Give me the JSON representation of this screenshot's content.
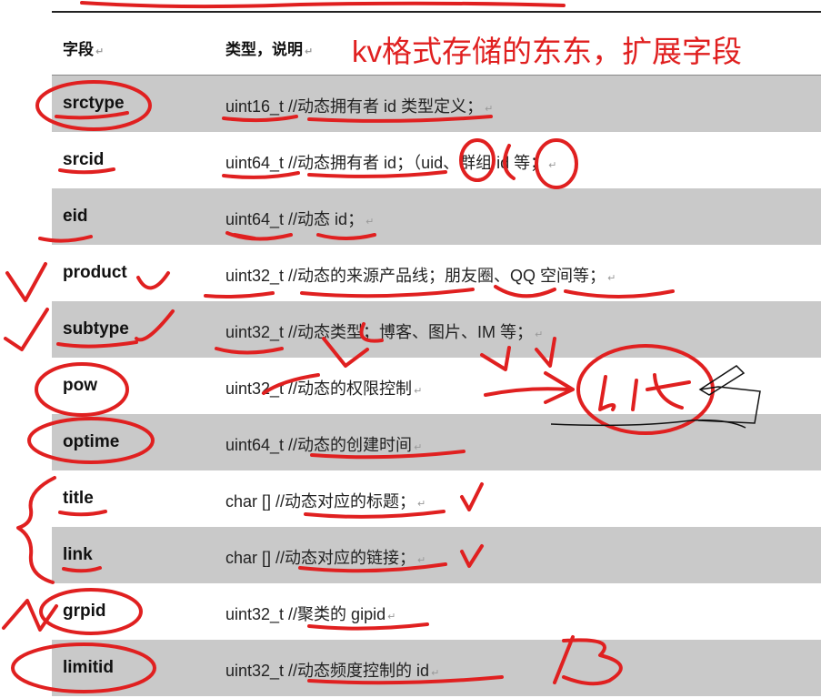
{
  "header": {
    "col_field": "字段",
    "col_type": "类型，说明",
    "annotation": "kv格式存储的东东，扩展字段"
  },
  "rows": [
    {
      "field": "srctype",
      "desc": "uint16_t //动态拥有者 id 类型定义；"
    },
    {
      "field": "srcid",
      "desc": "uint64_t //动态拥有者 id；（uid、群组 id 等；"
    },
    {
      "field": "eid",
      "desc": "uint64_t //动态 id；"
    },
    {
      "field": "product",
      "desc": "uint32_t //动态的来源产品线；朋友圈、QQ 空间等；"
    },
    {
      "field": "subtype",
      "desc": "uint32_t //动态类型；博客、图片、IM 等；"
    },
    {
      "field": "pow",
      "desc": "uint32_t //动态的权限控制"
    },
    {
      "field": "optime",
      "desc": "uint64_t //动态的创建时间"
    },
    {
      "field": "title",
      "desc": "char [] //动态对应的标题；"
    },
    {
      "field": "link",
      "desc": "char [] //动态对应的链接；"
    },
    {
      "field": "grpid",
      "desc": "uint32_t //聚类的 gipid"
    },
    {
      "field": "limitid",
      "desc": "uint32_t //动态频度控制的 id"
    }
  ],
  "ink": {
    "color": "#e02020",
    "bit_label": "bit",
    "five_label": "5"
  },
  "para_mark": "↵"
}
